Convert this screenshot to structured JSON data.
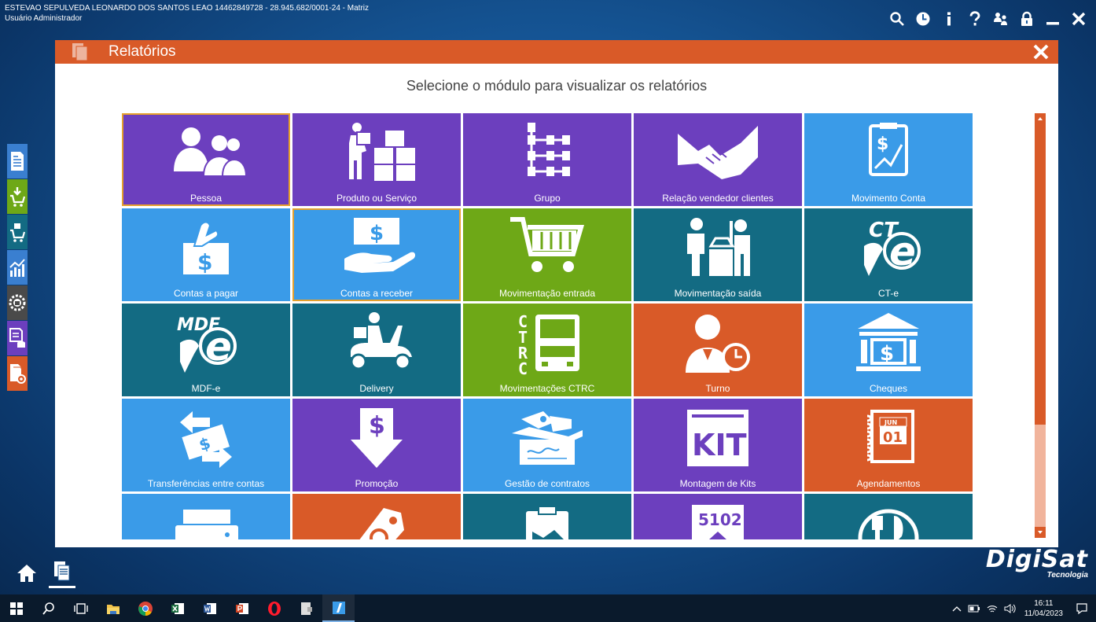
{
  "header": {
    "company": "ESTEVAO SEPULVEDA LEONARDO DOS SANTOS LEAO 14462849728 - 28.945.682/0001-24 - Matriz",
    "user": "Usuário Administrador"
  },
  "top_icons": [
    "search-icon",
    "clock-icon",
    "info-icon",
    "help-icon",
    "users-icon",
    "lock-icon",
    "minimize-icon",
    "close-icon"
  ],
  "modal": {
    "title": "Relatórios",
    "subtitle": "Selecione o módulo para visualizar os relatórios"
  },
  "colors": {
    "purple": "#6c3fbe",
    "lightblue": "#3a9be8",
    "teal": "#136b83",
    "green": "#6ea817",
    "orange": "#d95a28",
    "accent": "#d95a28"
  },
  "tiles": [
    {
      "label": "Pessoa",
      "color": "#6c3fbe",
      "icon": "people",
      "selected": true
    },
    {
      "label": "Produto ou Serviço",
      "color": "#6c3fbe",
      "icon": "boxes"
    },
    {
      "label": "Grupo",
      "color": "#6c3fbe",
      "icon": "hierarchy"
    },
    {
      "label": "Relação vendedor clientes",
      "color": "#6c3fbe",
      "icon": "handshake"
    },
    {
      "label": "Movimento Conta",
      "color": "#3a9be8",
      "icon": "clipboard-chart"
    },
    {
      "label": "Contas a pagar",
      "color": "#3a9be8",
      "icon": "pay"
    },
    {
      "label": "Contas a receber",
      "color": "#3a9be8",
      "icon": "receive",
      "selected": true
    },
    {
      "label": "Movimentação entrada",
      "color": "#6ea817",
      "icon": "cart"
    },
    {
      "label": "Movimentação saída",
      "color": "#136b83",
      "icon": "checkout"
    },
    {
      "label": "CT-e",
      "color": "#136b83",
      "icon": "cte"
    },
    {
      "label": "MDF-e",
      "color": "#136b83",
      "icon": "mdfe"
    },
    {
      "label": "Delivery",
      "color": "#136b83",
      "icon": "scooter"
    },
    {
      "label": "Movimentações CTRC",
      "color": "#6ea817",
      "icon": "truck"
    },
    {
      "label": "Turno",
      "color": "#d95a28",
      "icon": "person-clock"
    },
    {
      "label": "Cheques",
      "color": "#3a9be8",
      "icon": "bank"
    },
    {
      "label": "Transferências entre contas",
      "color": "#3a9be8",
      "icon": "transfer"
    },
    {
      "label": "Promoção",
      "color": "#6c3fbe",
      "icon": "promo"
    },
    {
      "label": "Gestão de contratos",
      "color": "#3a9be8",
      "icon": "contract"
    },
    {
      "label": "Montagem de Kits",
      "color": "#6c3fbe",
      "icon": "kit"
    },
    {
      "label": "Agendamentos",
      "color": "#d95a28",
      "icon": "calendar",
      "cal_month": "JUN",
      "cal_day": "01"
    },
    {
      "label": "",
      "color": "#3a9be8",
      "icon": "printer"
    },
    {
      "label": "",
      "color": "#d95a28",
      "icon": "tag"
    },
    {
      "label": "",
      "color": "#136b83",
      "icon": "clipboard-map"
    },
    {
      "label": "",
      "color": "#6c3fbe",
      "icon": "cfop",
      "code": "5102"
    },
    {
      "label": "",
      "color": "#136b83",
      "icon": "dish"
    }
  ],
  "sidebar": [
    {
      "name": "document-icon",
      "color": "#3a7fd0"
    },
    {
      "name": "cart-download-icon",
      "color": "#6ea817"
    },
    {
      "name": "cart-box-icon",
      "color": "#136b83"
    },
    {
      "name": "chart-growth-icon",
      "color": "#3a7fd0"
    },
    {
      "name": "factory-gear-icon",
      "color": "#4a4a4a"
    },
    {
      "name": "report-database-icon",
      "color": "#6c3fbe"
    },
    {
      "name": "report-settings-icon",
      "color": "#d95a28"
    }
  ],
  "brand": {
    "name": "DigiSat",
    "tagline": "Tecnologia"
  },
  "taskbar": {
    "apps": [
      "windows-icon",
      "search-icon",
      "task-view-icon",
      "file-explorer-icon",
      "chrome-icon",
      "excel-icon",
      "word-icon",
      "powerpoint-icon",
      "opera-icon",
      "app-icon",
      "digisat-icon"
    ],
    "time": "16:11",
    "date": "11/04/2023"
  }
}
